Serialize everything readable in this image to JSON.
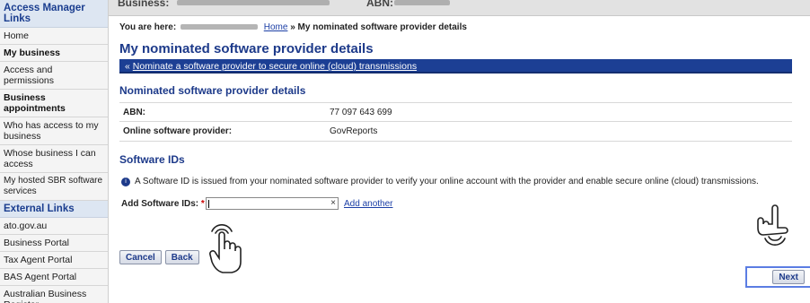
{
  "sidebar": {
    "section1_title": "Access Manager Links",
    "section1_items": [
      {
        "label": "Home",
        "bold": false
      },
      {
        "label": "My business",
        "bold": true
      },
      {
        "label": "Access and permissions",
        "bold": false
      },
      {
        "label": "Business appointments",
        "bold": true
      },
      {
        "label": "Who has access to my business",
        "bold": false
      },
      {
        "label": "Whose business I can access",
        "bold": false
      },
      {
        "label": "My hosted SBR software services",
        "bold": false
      }
    ],
    "section2_title": "External Links",
    "section2_items": [
      {
        "label": "ato.gov.au"
      },
      {
        "label": "Business Portal"
      },
      {
        "label": "Tax Agent Portal"
      },
      {
        "label": "BAS Agent Portal"
      },
      {
        "label": "Australian Business Register"
      }
    ]
  },
  "topbar": {
    "business_label": "Business:",
    "abn_label": "ABN:"
  },
  "breadcrumb": {
    "prefix": "You are here:",
    "home": "Home",
    "separator": "»",
    "current": "My nominated software provider details"
  },
  "page_title": "My nominated software provider details",
  "banner": {
    "chevron": "«",
    "link": "Nominate a software provider to secure online (cloud) transmissions"
  },
  "details": {
    "heading": "Nominated software provider details",
    "rows": [
      {
        "key": "ABN:",
        "value": "77 097 643 699"
      },
      {
        "key": "Online software provider:",
        "value": "GovReports"
      }
    ]
  },
  "software_ids": {
    "heading": "Software IDs",
    "info_icon": "i",
    "info_text": "A Software ID is issued from your nominated software provider to verify your online account with the provider and enable secure online (cloud) transmissions.",
    "field_label": "Add Software IDs:",
    "required_mark": "*",
    "field_value": "",
    "clear_icon": "×",
    "add_another": "Add another"
  },
  "buttons": {
    "cancel": "Cancel",
    "back": "Back",
    "next": "Next"
  },
  "colors": {
    "heading_blue": "#1d3a8a",
    "banner_blue": "#1c3f94",
    "highlight": "#5b7de3"
  }
}
